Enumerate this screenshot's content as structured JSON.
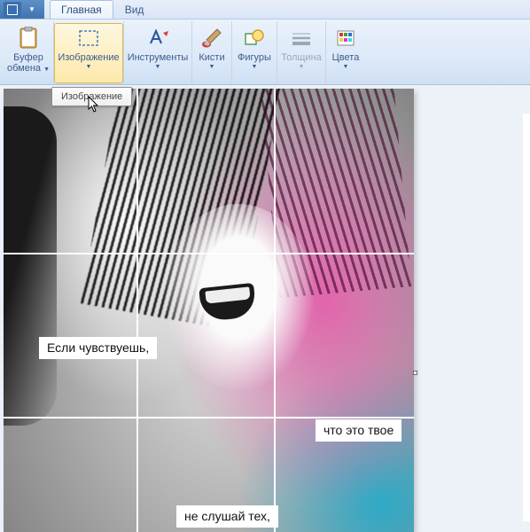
{
  "titlebar": {
    "tabs": [
      {
        "label": "Главная",
        "active": true
      },
      {
        "label": "Вид",
        "active": false
      }
    ]
  },
  "ribbon": {
    "clipboard": {
      "label_line1": "Буфер",
      "label_line2": "обмена"
    },
    "image": {
      "label": "Изображение",
      "tooltip": "Изображение"
    },
    "tools": {
      "label": "Инструменты"
    },
    "brushes": {
      "label": "Кисти"
    },
    "shapes": {
      "label": "Фигуры"
    },
    "thickness": {
      "label": "Толщина"
    },
    "colors": {
      "label": "Цвета"
    }
  },
  "canvas": {
    "caption1": "Если чувствуешь,",
    "caption2": "что это твое",
    "caption3": "не слушай тех,"
  }
}
